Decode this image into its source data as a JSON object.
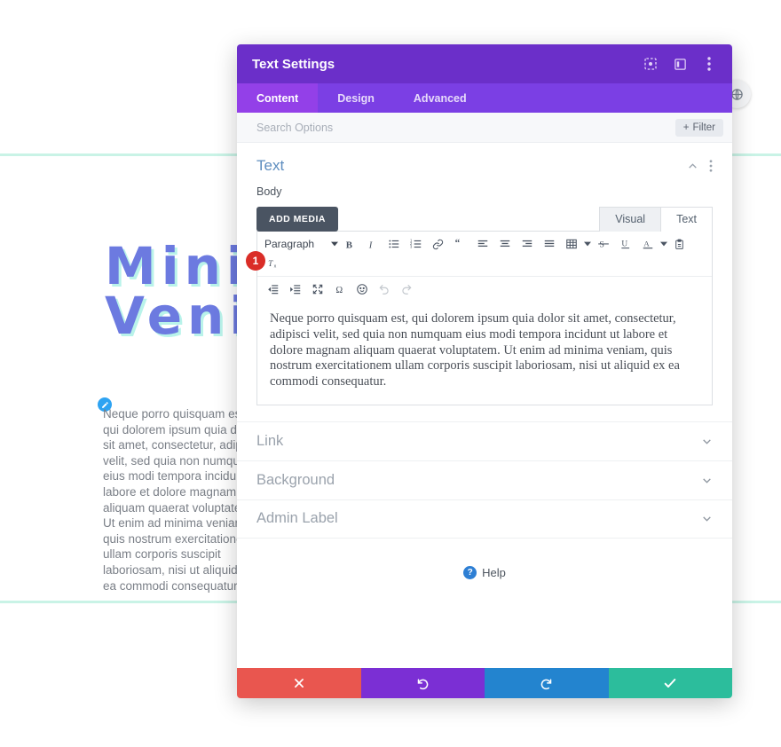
{
  "background": {
    "hero_line1": "Mini",
    "hero_line2": "Veni",
    "hero_color": "#6c7ae0",
    "hero_shadow_color": "#b9f3ea",
    "rule_color": "#c9f3e6",
    "paragraph": "Neque porro quisquam est, qui dolorem ipsum quia dolor sit amet, consectetur, adipisci velit, sed quia non numquam eius modi tempora incidunt ut labore et dolore magnam aliquam quaerat voluptatem. Ut enim ad minima veniam, quis nostrum exercitationem ullam corporis suscipit laboriosam, nisi ut aliquid ex ea commodi consequatur.",
    "edit_pin_icon": "pencil-icon",
    "circle_button_icon": "globe-icon"
  },
  "modal": {
    "title": "Text Settings",
    "header_color": "#6b2fc9",
    "header_icons": [
      {
        "name": "focus-target-icon"
      },
      {
        "name": "layout-toggle-icon"
      },
      {
        "name": "more-vertical-icon"
      }
    ],
    "tabs": [
      {
        "label": "Content",
        "active": true
      },
      {
        "label": "Design",
        "active": false
      },
      {
        "label": "Advanced",
        "active": false
      }
    ],
    "tab_bar_color": "#7b3fe4",
    "tab_active_color": "#9340e8",
    "search": {
      "value": "",
      "placeholder": "Search Options",
      "filter_label": "Filter",
      "filter_icon": "plus-icon"
    },
    "text_section": {
      "title": "Text",
      "collapse_icon": "chevron-up-icon",
      "menu_icon": "more-vertical-icon",
      "field_label": "Body",
      "add_media_label": "ADD MEDIA",
      "editor_tabs": [
        {
          "label": "Visual",
          "active": false
        },
        {
          "label": "Text",
          "active": true
        }
      ],
      "toolbar_row1": [
        {
          "name": "paragraph-format-select",
          "label": "Paragraph",
          "type": "select"
        },
        {
          "name": "bold-icon",
          "type": "icon"
        },
        {
          "name": "italic-icon",
          "type": "icon"
        },
        {
          "name": "bulleted-list-icon",
          "type": "icon"
        },
        {
          "name": "numbered-list-icon",
          "type": "icon"
        },
        {
          "name": "link-icon",
          "type": "icon"
        },
        {
          "name": "blockquote-icon",
          "type": "icon"
        },
        {
          "name": "align-left-icon",
          "type": "icon"
        },
        {
          "name": "align-center-icon",
          "type": "icon"
        },
        {
          "name": "align-right-icon",
          "type": "icon"
        },
        {
          "name": "align-justify-icon",
          "type": "icon"
        },
        {
          "name": "table-icon",
          "type": "icon-caret"
        },
        {
          "name": "strikethrough-icon",
          "type": "icon"
        },
        {
          "name": "underline-icon",
          "type": "icon"
        },
        {
          "name": "text-color-icon",
          "type": "icon-caret"
        },
        {
          "name": "paste-as-text-icon",
          "type": "icon"
        },
        {
          "name": "clear-formatting-icon",
          "type": "icon"
        }
      ],
      "toolbar_row2": [
        {
          "name": "outdent-icon",
          "type": "icon"
        },
        {
          "name": "indent-icon",
          "type": "icon"
        },
        {
          "name": "fullscreen-icon",
          "type": "icon"
        },
        {
          "name": "special-character-icon",
          "type": "icon"
        },
        {
          "name": "emoji-icon",
          "type": "icon"
        },
        {
          "name": "undo-icon",
          "type": "icon",
          "disabled": true
        },
        {
          "name": "redo-icon",
          "type": "icon",
          "disabled": true
        }
      ],
      "content": "Neque porro quisquam est, qui dolorem ipsum quia dolor sit amet, consectetur, adipisci velit, sed quia non numquam eius modi tempora incidunt ut labore et dolore magnam aliquam quaerat voluptatem. Ut enim ad minima veniam, quis nostrum exercitationem ullam corporis suscipit laboriosam, nisi ut aliquid ex ea commodi consequatur.",
      "step_badge": "1",
      "step_badge_color": "#da2d27"
    },
    "collapsed_sections": [
      {
        "label": "Link",
        "chevron": "chevron-down-icon"
      },
      {
        "label": "Background",
        "chevron": "chevron-down-icon"
      },
      {
        "label": "Admin Label",
        "chevron": "chevron-down-icon"
      }
    ],
    "help": {
      "label": "Help",
      "icon": "question-mark-icon"
    },
    "footer_buttons": [
      {
        "name": "cancel-button",
        "icon": "close-icon",
        "color": "#e9564f"
      },
      {
        "name": "undo-button",
        "icon": "undo-icon",
        "color": "#7b2fd4"
      },
      {
        "name": "redo-button",
        "icon": "redo-icon",
        "color": "#2384cf"
      },
      {
        "name": "save-button",
        "icon": "check-icon",
        "color": "#2cbd9c"
      }
    ]
  }
}
